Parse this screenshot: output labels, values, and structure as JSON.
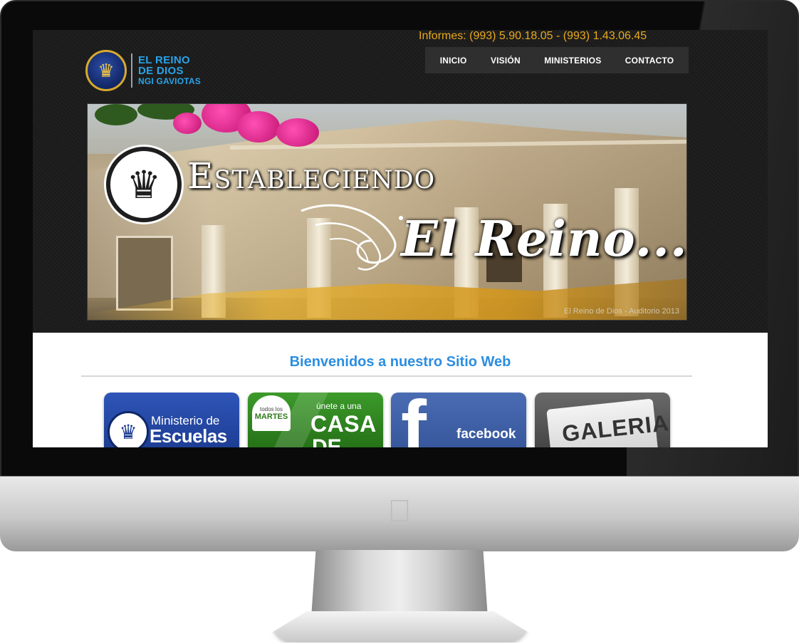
{
  "header": {
    "contact": "Informes: (993) 5.90.18.05 - (993) 1.43.06.45",
    "logo": {
      "line1": "EL REINO",
      "line2": "DE DIOS",
      "line3": "NGI GAVIOTAS"
    },
    "nav": [
      {
        "label": "INICIO"
      },
      {
        "label": "VISIÓN"
      },
      {
        "label": "MINISTERIOS"
      },
      {
        "label": "CONTACTO"
      }
    ]
  },
  "banner": {
    "title": "Estableciendo",
    "script": "El Reino...",
    "caption": "El Reino de Dios - Auditorio 2013"
  },
  "content": {
    "welcome": "Bienvenidos a nuestro Sitio Web",
    "tiles": {
      "escuelas": {
        "line1": "Ministerio de",
        "line2": "Escuelas"
      },
      "casa": {
        "badge_small": "todos los",
        "badge_big": "MARTES",
        "line1": "únete a una",
        "line2": "CASA",
        "line3": "DE PAZ"
      },
      "facebook": {
        "glyph": "f",
        "word": "facebook"
      },
      "galeria": {
        "word": "GALERIA"
      }
    }
  },
  "colors": {
    "accent_blue": "#2b8ee0",
    "contact_gold": "#e8a91b",
    "nav_bg": "#2f2f2f"
  },
  "icons": {
    "logo_seal": "crown-icon",
    "apple": "apple-logo-icon"
  }
}
